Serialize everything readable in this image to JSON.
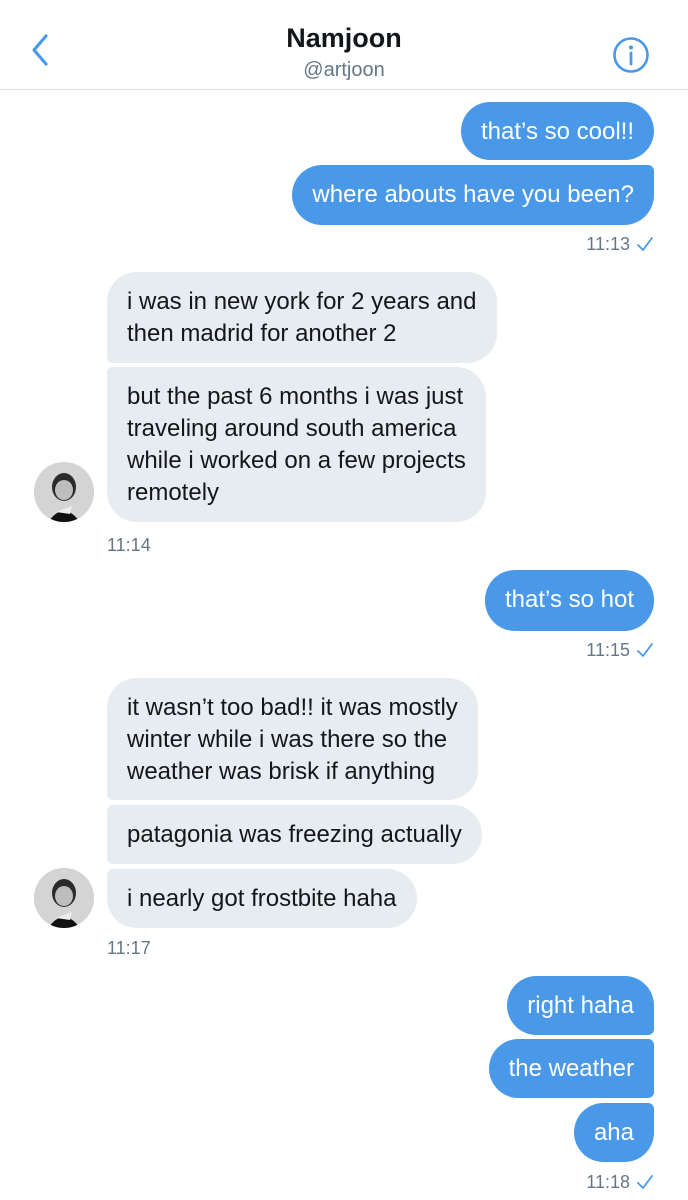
{
  "header": {
    "title": "Namjoon",
    "handle": "@artjoon",
    "back_icon": "chevron-left-icon",
    "info_icon": "info-icon",
    "accent": "#4a99e9"
  },
  "messages": {
    "m1": "that’s so cool!!",
    "m2": "where abouts have you been?",
    "t1": "11:13",
    "m3_l1": "i was in new york for 2 years and",
    "m3_l2": "then madrid for another 2",
    "m4_l1": "but the past 6 months i was just",
    "m4_l2": "traveling around south america",
    "m4_l3": "while i worked on a few projects",
    "m4_l4": "remotely",
    "t2": "11:14",
    "m5": "that’s so hot",
    "t3": "11:15",
    "m6_l1": "it wasn’t too bad!! it was mostly",
    "m6_l2": "winter while i was there so the",
    "m6_l3": "weather was brisk if anything",
    "m7": "patagonia was freezing actually",
    "m8": "i nearly got frostbite haha",
    "t4": "11:17",
    "m9": "right haha",
    "m10": "the weather",
    "m11": "aha",
    "t5": "11:18"
  },
  "colors": {
    "outgoing_bubble": "#4a99e9",
    "incoming_bubble": "#e6ecf0",
    "timestamp": "#657786"
  }
}
